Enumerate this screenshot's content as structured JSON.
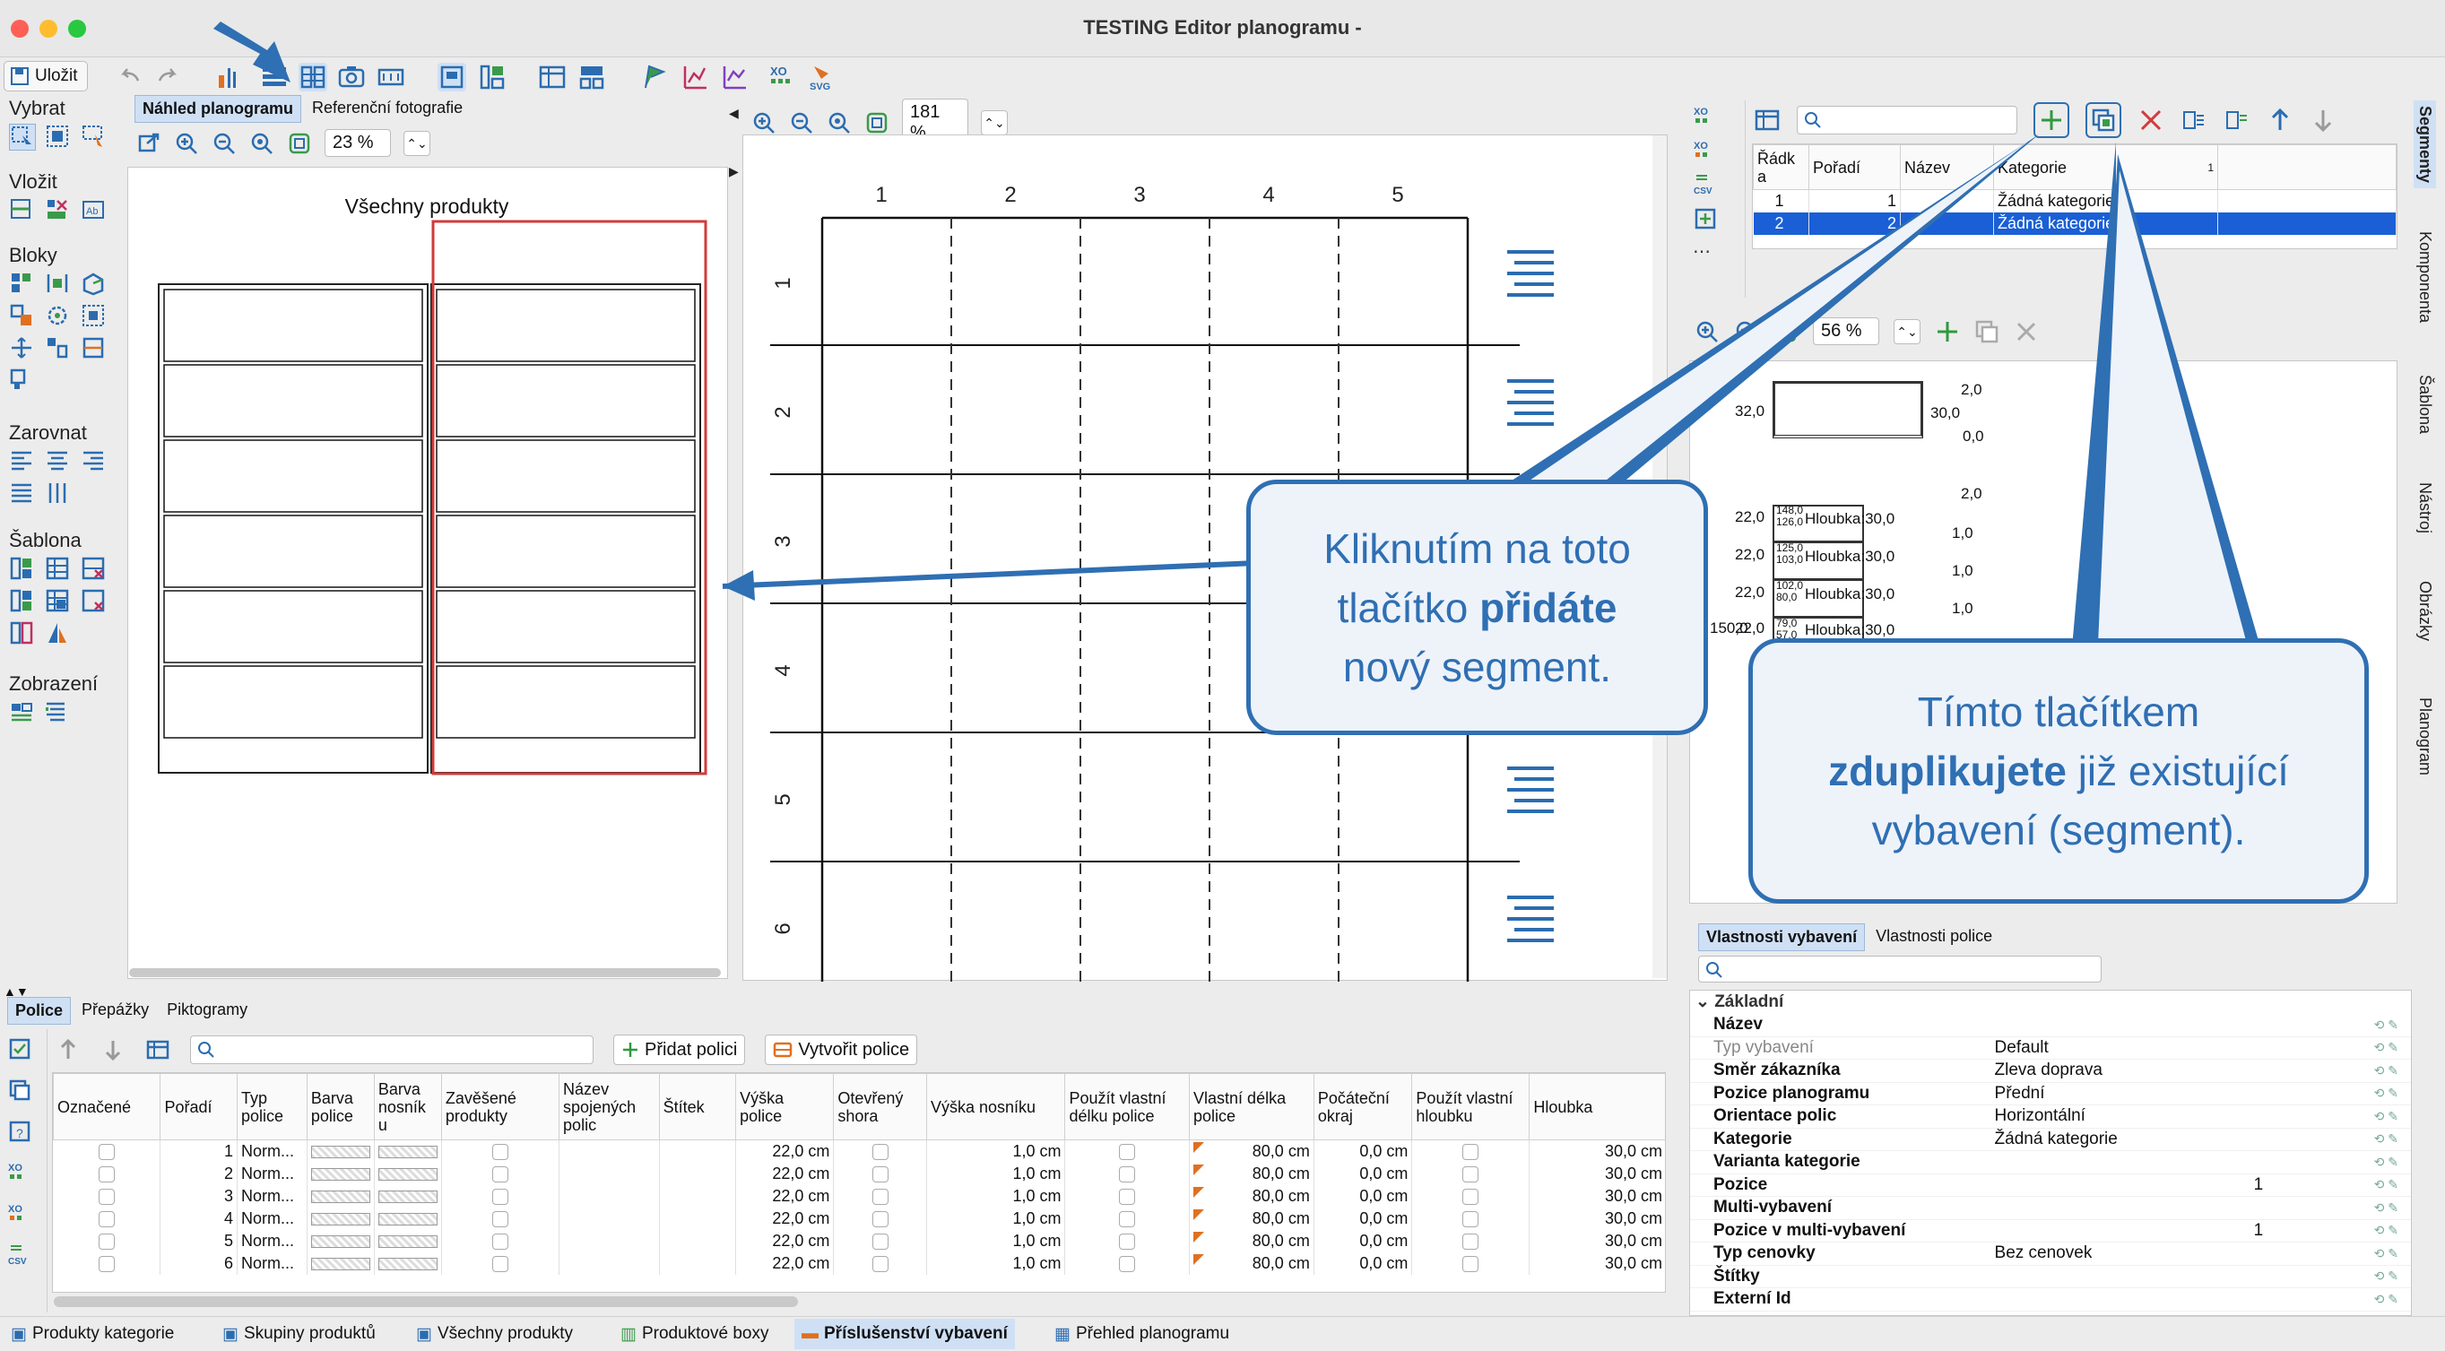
{
  "window": {
    "title": "TESTING Editor planogramu -"
  },
  "toolbar": {
    "save_label": "Uložit"
  },
  "left_tools": {
    "groups": [
      "Vybrat",
      "Vložit",
      "Bloky",
      "Zarovnat",
      "Šablona",
      "Zobrazení"
    ]
  },
  "preview": {
    "tabs": [
      "Náhled planogramu",
      "Referenční fotografie"
    ],
    "zoom": "23 %",
    "heading": "Všechny produkty"
  },
  "canvas": {
    "zoom": "181 %",
    "columns": [
      "1",
      "2",
      "3",
      "4",
      "5"
    ],
    "rows": [
      "1",
      "2",
      "3",
      "4",
      "5",
      "6"
    ]
  },
  "segments": {
    "columns": [
      "Řádk a",
      "Pořadí",
      "Název",
      "Kategorie"
    ],
    "sort_badge": "1",
    "rows": [
      {
        "row": "1",
        "order": "1",
        "name": "",
        "category": "Žádná kategorie",
        "selected": false
      },
      {
        "row": "2",
        "order": "2",
        "name": "",
        "category": "Žádná kategorie",
        "selected": true
      }
    ]
  },
  "detail": {
    "zoom": "56 %",
    "dims": {
      "top": "2,0",
      "left_top": "32,0",
      "right_top": "30,0",
      "zero": "0,0",
      "top2": "2,0",
      "side": "150,0",
      "shelves": [
        {
          "left": "22,0",
          "a": "148,0",
          "b": "126,0",
          "label": "Hloubka:30,0",
          "right": "1,0"
        },
        {
          "left": "22,0",
          "a": "125,0",
          "b": "103,0",
          "label": "Hloubka:30,0",
          "right": "1,0"
        },
        {
          "left": "22,0",
          "a": "102,0",
          "b": "80,0",
          "label": "Hloubka:30,0",
          "right": "1,0"
        },
        {
          "left": "22,0",
          "a": "79,0",
          "b": "57,0",
          "label": "Hloubka:30,0",
          "right": ""
        }
      ]
    }
  },
  "side_tabs": [
    "Segmenty",
    "Komponenta",
    "Šablona",
    "Nástroj",
    "Obrázky",
    "Planogram"
  ],
  "properties": {
    "tabs": [
      "Vlastnosti vybavení",
      "Vlastnosti police"
    ],
    "section": "Základní",
    "rows": [
      {
        "name": "Název",
        "value": "",
        "dim": false
      },
      {
        "name": "Typ vybavení",
        "value": "Default",
        "dim": true
      },
      {
        "name": "Směr zákazníka",
        "value": "Zleva doprava",
        "dim": false
      },
      {
        "name": "Pozice planogramu",
        "value": "Přední",
        "dim": false
      },
      {
        "name": "Orientace polic",
        "value": "Horizontální",
        "dim": false
      },
      {
        "name": "Kategorie",
        "value": "Žádná kategorie",
        "dim": false
      },
      {
        "name": "Varianta kategorie",
        "value": "",
        "dim": false
      },
      {
        "name": "Pozice",
        "value": "1",
        "dim": false
      },
      {
        "name": "Multi-vybavení",
        "value": "",
        "dim": false
      },
      {
        "name": "Pozice v multi-vybavení",
        "value": "1",
        "dim": false
      },
      {
        "name": "Typ cenovky",
        "value": "Bez cenovek",
        "dim": false
      },
      {
        "name": "Štítky",
        "value": "",
        "dim": false
      },
      {
        "name": "Externí Id",
        "value": "",
        "dim": false
      }
    ]
  },
  "shelves": {
    "tabs": [
      "Police",
      "Přepážky",
      "Piktogramy"
    ],
    "add_label": "Přidat polici",
    "create_label": "Vytvořit police",
    "columns": [
      "Označené",
      "Pořadí",
      "Typ police",
      "Barva police",
      "Barva nosník u",
      "Zavěšené produkty",
      "Název spojených polic",
      "Štítek",
      "Výška police",
      "Otevřený shora",
      "Výška nosníku",
      "Použít vlastní délku police",
      "Vlastní délka police",
      "Počáteční okraj",
      "Použít vlastní hloubku",
      "Hloubka"
    ],
    "rows": [
      {
        "order": "1",
        "type": "Norm...",
        "height": "22,0 cm",
        "beam": "1,0 cm",
        "length": "80,0 cm",
        "margin": "0,0 cm",
        "depth": "30,0 cm"
      },
      {
        "order": "2",
        "type": "Norm...",
        "height": "22,0 cm",
        "beam": "1,0 cm",
        "length": "80,0 cm",
        "margin": "0,0 cm",
        "depth": "30,0 cm"
      },
      {
        "order": "3",
        "type": "Norm...",
        "height": "22,0 cm",
        "beam": "1,0 cm",
        "length": "80,0 cm",
        "margin": "0,0 cm",
        "depth": "30,0 cm"
      },
      {
        "order": "4",
        "type": "Norm...",
        "height": "22,0 cm",
        "beam": "1,0 cm",
        "length": "80,0 cm",
        "margin": "0,0 cm",
        "depth": "30,0 cm"
      },
      {
        "order": "5",
        "type": "Norm...",
        "height": "22,0 cm",
        "beam": "1,0 cm",
        "length": "80,0 cm",
        "margin": "0,0 cm",
        "depth": "30,0 cm"
      },
      {
        "order": "6",
        "type": "Norm...",
        "height": "22,0 cm",
        "beam": "1,0 cm",
        "length": "80,0 cm",
        "margin": "0,0 cm",
        "depth": "30,0 cm"
      }
    ]
  },
  "bottom_tabs": [
    "Produkty kategorie",
    "Skupiny produktů",
    "Všechny produkty",
    "Produktové boxy",
    "Příslušenství vybavení",
    "Přehled planogramu"
  ],
  "callouts": {
    "add": {
      "l1": "Kliknutím na toto",
      "l2a": "tlačítko ",
      "l2b": "přidáte",
      "l3": "nový segment."
    },
    "dup": {
      "l1": "Tímto tlačítkem",
      "l2a": "zduplikujete",
      "l2b": " již existující",
      "l3": "vybavení (segment)."
    }
  },
  "colors": {
    "accent": "#2f6fb3",
    "selection": "#1a5fd6",
    "frame_red": "#d23a3a"
  }
}
